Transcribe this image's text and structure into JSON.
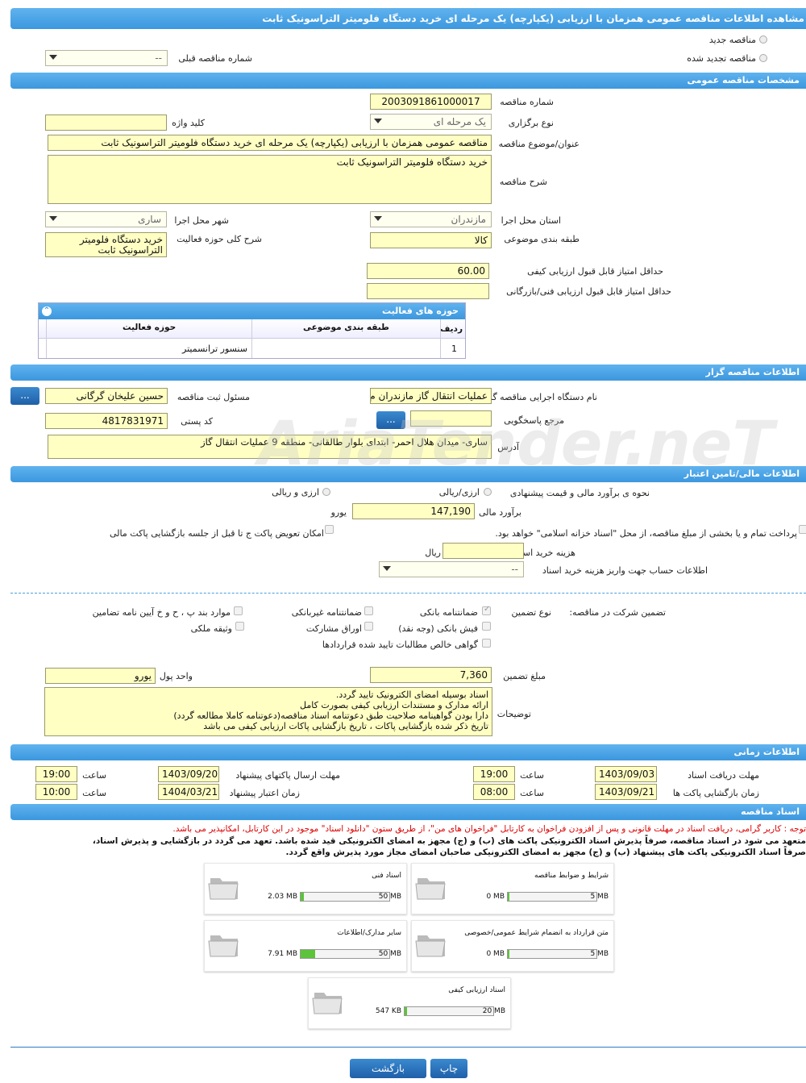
{
  "page_title": "مشاهده اطلاعات مناقصه عمومی همزمان با ارزیابی (یکپارچه) یک مرحله ای خرید دستگاه فلومیتر التراسونیک ثابت",
  "top": {
    "new_label": "مناقصه جدید",
    "renew_label": "مناقصه تجدید شده",
    "prev_label": "شماره مناقصه قبلی",
    "prev_value": "--"
  },
  "general": {
    "header": "مشخصات مناقصه عمومی",
    "number_label": "شماره مناقصه",
    "number": "2003091861000017",
    "type_label": "نوع برگزاری",
    "type": "یک مرحله ای",
    "keyword_label": "کلید واژه",
    "keyword": "",
    "subject_label": "عنوان/موضوع مناقصه",
    "subject": "مناقصه عمومی همزمان با ارزیابی (یکپارچه) یک مرحله ای خرید دستگاه فلومیتر التراسونیک ثابت",
    "desc_label": "شرح مناقصه",
    "desc": "خرید دستگاه فلومیتر التراسونیک ثابت",
    "province_label": "استان محل اجرا",
    "province": "مازندران",
    "city_label": "شهر محل اجرا",
    "city": "ساری",
    "category_label": "طبقه بندی موضوعی",
    "category": "کالا",
    "scope_label": "شرح کلی حوزه فعالیت",
    "scope": "خرید دستگاه فلومیتر التراسونیک ثابت",
    "min_quality_label": "حداقل امتیاز قابل قبول ارزیابی کیفی",
    "min_quality": "60.00",
    "min_tech_label": "حداقل امتیاز قابل قبول ارزیابی فنی/بازرگانی",
    "min_tech": ""
  },
  "activity": {
    "header": "حوزه های فعالیت",
    "col_row": "ردیف",
    "col_cat": "طبقه بندی موضوعی",
    "col_field": "حوزه فعالیت",
    "rows": [
      {
        "row": "1",
        "cat": "",
        "field": "سنسور ترانسمیتر"
      }
    ]
  },
  "organizer": {
    "header": "اطلاعات مناقصه گزار",
    "org_label": "نام دستگاه اجرایی مناقصه گزار",
    "org": "عملیات انتقال گاز مازندران م",
    "responsible_label": "مسئول ثبت مناقصه",
    "responsible": "حسین علیخان گرگانی",
    "ref_label": "مرجع پاسخگویی",
    "ref": "",
    "postal_label": "کد پستی",
    "postal": "4817831971",
    "address_label": "آدرس",
    "address": "ساری- میدان هلال احمر- ابتدای بلوار طالقانی- منطقه 9 عملیات انتقال گاز",
    "dots": "..."
  },
  "finance": {
    "header": "اطلاعات مالی/تامین اعتبار",
    "method_label": "نحوه ی برآورد مالی و قیمت پیشنهادی",
    "opt1": "ارزی/ریالی",
    "opt2": "ارزی و ریالی",
    "estimate_label": "برآورد مالی",
    "estimate": "147,190",
    "estimate_unit": "یورو",
    "treasury_label": "پرداخت تمام و یا بخشی از مبلغ مناقصه، از محل \"اسناد خزانه اسلامی\" خواهد بود.",
    "swap_label": "امکان تعویض پاکت ج تا قبل از جلسه بازگشایی پاکت مالی",
    "fee_label": "هزینه خرید اسناد",
    "fee": "",
    "fee_unit": "ریال",
    "account_label": "اطلاعات حساب جهت واریز هزینه خرید اسناد",
    "account": "--"
  },
  "guarantee": {
    "label": "تضمین شرکت در مناقصه:",
    "type_label": "نوع تضمین",
    "items": [
      "ضمانتنامه بانکی",
      "ضمانتنامه غیربانکی",
      "موارد بند پ ، ح و خ آیین نامه تضامین",
      "فیش بانکی (وجه نقد)",
      "اوراق مشارکت",
      "وثیقه ملکی",
      "گواهی خالص مطالبات تایید شده قراردادها"
    ],
    "amount_label": "مبلغ تضمین",
    "amount": "7,360",
    "currency_label": "واحد پول",
    "currency": "یورو",
    "notes_label": "توضیحات",
    "notes": "اسناد بوسیله امضای الکترونیک تایید گردد.\nارائه مدارک و مستندات ارزیابی کیفی بصورت کامل\nدارا بودن گواهینامه صلاحیت طبق دعوتنامه اسناد مناقصه(دعوتنامه کاملا مطالعه گردد)\nتاریخ ذکر شده بازگشایی پاکات ، تاریخ بازگشایی پاکات ارزیابی کیفی می باشد"
  },
  "timing": {
    "header": "اطلاعات زمانی",
    "receive_label": "مهلت دریافت اسناد",
    "receive_date": "1403/09/03",
    "receive_time": "19:00",
    "send_label": "مهلت ارسال پاکتهای پیشنهاد",
    "send_date": "1403/09/20",
    "send_time": "19:00",
    "open_label": "زمان بازگشایی پاکت ها",
    "open_date": "1403/09/21",
    "open_time": "08:00",
    "valid_label": "زمان اعتبار پیشنهاد",
    "valid_date": "1404/03/21",
    "valid_time": "10:00",
    "time_label": "ساعت"
  },
  "docs": {
    "header": "اسناد مناقصه",
    "note1": "توجه : کاربر گرامی، دریافت اسناد در مهلت قانونی و پس از افزودن فراخوان به کارتابل \"فراخوان های من\"، از طریق ستون \"دانلود اسناد\" موجود در این کارتابل، امکانپذیر می باشد.",
    "note2": "متعهد می شود در اسناد مناقصه، صرفاً پذیرش اسناد الکترونیکی پاکت های (ب) و (ج) مجهز به امضای الکترونیکی قید شده باشد. تعهد می گردد در بازگشایی و پذیرش اسناد،",
    "note3": "صرفاً اسناد الکترونیکی پاکت های پیشنهاد (ب) و (ج) مجهز به امضای الکترونیکی صاحبان امضای مجاز مورد پذیرش واقع گردد.",
    "files": [
      {
        "name": "شرایط و ضوابط مناقصه",
        "max": "5 MB",
        "size": "0 MB",
        "pct": 0
      },
      {
        "name": "اسناد فنی",
        "max": "50 MB",
        "size": "2.03 MB",
        "pct": 0.04
      },
      {
        "name": "متن قرارداد به انضمام شرایط عمومی/خصوصی",
        "max": "5 MB",
        "size": "0 MB",
        "pct": 0
      },
      {
        "name": "سایر مدارک/اطلاعات",
        "max": "50 MB",
        "size": "7.91 MB",
        "pct": 0.16
      },
      {
        "name": "اسناد ارزیابی کیفی",
        "max": "20 MB",
        "size": "547 KB",
        "pct": 0.03
      }
    ]
  },
  "buttons": {
    "print": "چاپ",
    "back": "بازگشت"
  },
  "watermark": "AriaTender.neT"
}
